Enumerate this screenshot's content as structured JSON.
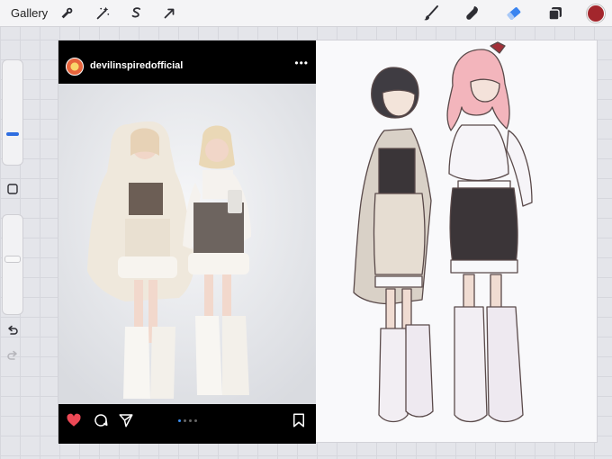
{
  "toolbar": {
    "gallery_label": "Gallery",
    "left_tools": [
      "wrench-icon",
      "magic-wand-icon",
      "selection-icon",
      "transform-arrow-icon"
    ],
    "right_tools": [
      "brush-icon",
      "smudge-icon",
      "eraser-icon",
      "layers-icon"
    ],
    "current_color": "#a3262c"
  },
  "sidebar": {
    "brush_size_level": 0.27,
    "opacity_level": 0.55
  },
  "instagram": {
    "username": "devilinspiredofficial",
    "more_glyph": "•••",
    "carousel_total": 4,
    "carousel_active": 1,
    "liked": true,
    "heart_color": "#ed4956"
  },
  "colors": {
    "sidebar_accent": "#2f6ee0",
    "ui_icon": "#2d2d33",
    "canvas_bg": "#f9f9fb"
  }
}
